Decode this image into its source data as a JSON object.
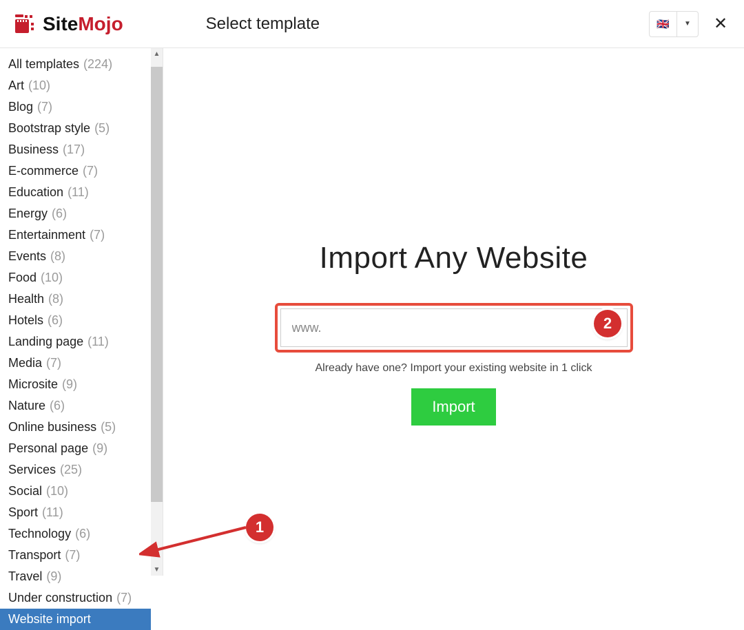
{
  "brand": {
    "name_main": "Site",
    "name_accent": "Mojo"
  },
  "header": {
    "title": "Select template",
    "flag_emoji": "🇬🇧",
    "close_glyph": "✕",
    "dropdown_glyph": "▼"
  },
  "sidebar": {
    "items": [
      {
        "label": "All templates",
        "count": "(224)",
        "selected": false
      },
      {
        "label": "Art",
        "count": "(10)",
        "selected": false
      },
      {
        "label": "Blog",
        "count": "(7)",
        "selected": false
      },
      {
        "label": "Bootstrap style",
        "count": "(5)",
        "selected": false
      },
      {
        "label": "Business",
        "count": "(17)",
        "selected": false
      },
      {
        "label": "E-commerce",
        "count": "(7)",
        "selected": false
      },
      {
        "label": "Education",
        "count": "(11)",
        "selected": false
      },
      {
        "label": "Energy",
        "count": "(6)",
        "selected": false
      },
      {
        "label": "Entertainment",
        "count": "(7)",
        "selected": false
      },
      {
        "label": "Events",
        "count": "(8)",
        "selected": false
      },
      {
        "label": "Food",
        "count": "(10)",
        "selected": false
      },
      {
        "label": "Health",
        "count": "(8)",
        "selected": false
      },
      {
        "label": "Hotels",
        "count": "(6)",
        "selected": false
      },
      {
        "label": "Landing page",
        "count": "(11)",
        "selected": false
      },
      {
        "label": "Media",
        "count": "(7)",
        "selected": false
      },
      {
        "label": "Microsite",
        "count": "(9)",
        "selected": false
      },
      {
        "label": "Nature",
        "count": "(6)",
        "selected": false
      },
      {
        "label": "Online business",
        "count": "(5)",
        "selected": false
      },
      {
        "label": "Personal page",
        "count": "(9)",
        "selected": false
      },
      {
        "label": "Services",
        "count": "(25)",
        "selected": false
      },
      {
        "label": "Social",
        "count": "(10)",
        "selected": false
      },
      {
        "label": "Sport",
        "count": "(11)",
        "selected": false
      },
      {
        "label": "Technology",
        "count": "(6)",
        "selected": false
      },
      {
        "label": "Transport",
        "count": "(7)",
        "selected": false
      },
      {
        "label": "Travel",
        "count": "(9)",
        "selected": false
      },
      {
        "label": "Under construction",
        "count": "(7)",
        "selected": false
      },
      {
        "label": "Website import",
        "count": "",
        "selected": true
      }
    ],
    "scroll_up_glyph": "▲",
    "scroll_down_glyph": "▼"
  },
  "import_pane": {
    "heading": "Import Any Website",
    "url_placeholder": "www.",
    "help_text": "Already have one? Import your existing website in 1 click",
    "button_label": "Import"
  },
  "annotations": {
    "badge1": "1",
    "badge2": "2"
  },
  "colors": {
    "brand_red": "#c51e2d",
    "highlight_red": "#e74c3c",
    "sidebar_selected": "#3b7bbf",
    "import_green": "#2ecc40",
    "badge_red": "#d32f2f"
  }
}
